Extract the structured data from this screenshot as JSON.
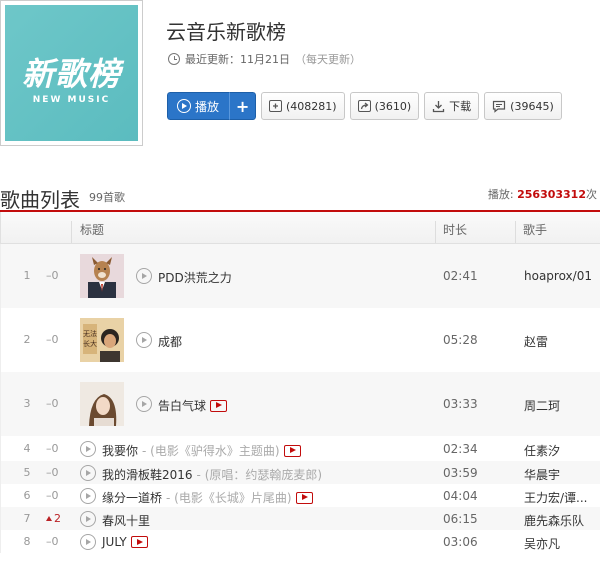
{
  "cover": {
    "title": "新歌榜",
    "subtitle": "NEW MUSIC"
  },
  "header": {
    "title": "云音乐新歌榜",
    "update_label": "最近更新：11月21日",
    "update_note": "（每天更新）"
  },
  "actions": {
    "play_label": "播放",
    "plus_label": "+",
    "collect_count": "(408281)",
    "share_count": "(3610)",
    "download_label": "下载",
    "comment_count": "(39645)"
  },
  "list": {
    "title": "歌曲列表",
    "count": "99首歌",
    "play_label": "播放:",
    "play_count": "256303312",
    "play_suffix": "次"
  },
  "columns": {
    "title": "标题",
    "duration": "时长",
    "artist": "歌手"
  },
  "songs": [
    {
      "index": "1",
      "trend": "–0",
      "name": "PDD洪荒之力",
      "alias": "",
      "mv": false,
      "duration": "02:41",
      "artist": "hoaprox/01"
    },
    {
      "index": "2",
      "trend": "–0",
      "name": "成都",
      "alias": "",
      "mv": false,
      "duration": "05:28",
      "artist": "赵雷"
    },
    {
      "index": "3",
      "trend": "–0",
      "name": "告白气球",
      "alias": "",
      "mv": true,
      "duration": "03:33",
      "artist": "周二珂"
    },
    {
      "index": "4",
      "trend": "–0",
      "name": "我要你",
      "alias": " - (电影《驴得水》主题曲)",
      "mv": true,
      "duration": "02:34",
      "artist": "任素汐"
    },
    {
      "index": "5",
      "trend": "–0",
      "name": "我的滑板鞋2016",
      "alias": " - (原唱：约瑟翰庞麦郎)",
      "mv": false,
      "duration": "03:59",
      "artist": "华晨宇"
    },
    {
      "index": "6",
      "trend": "–0",
      "name": "缘分一道桥",
      "alias": " - (电影《长城》片尾曲)",
      "mv": true,
      "duration": "04:04",
      "artist": "王力宏/谭..."
    },
    {
      "index": "7",
      "trend": "2",
      "trend_dir": "up",
      "name": "春风十里",
      "alias": "",
      "mv": false,
      "duration": "06:15",
      "artist": "鹿先森乐队"
    },
    {
      "index": "8",
      "trend": "–0",
      "name": "JULY",
      "alias": "",
      "mv": true,
      "duration": "03:06",
      "artist": "吴亦凡"
    }
  ],
  "colors": {
    "accent": "#c20c0c",
    "button": "#2b75c8",
    "cover": "#5bbcbf"
  }
}
